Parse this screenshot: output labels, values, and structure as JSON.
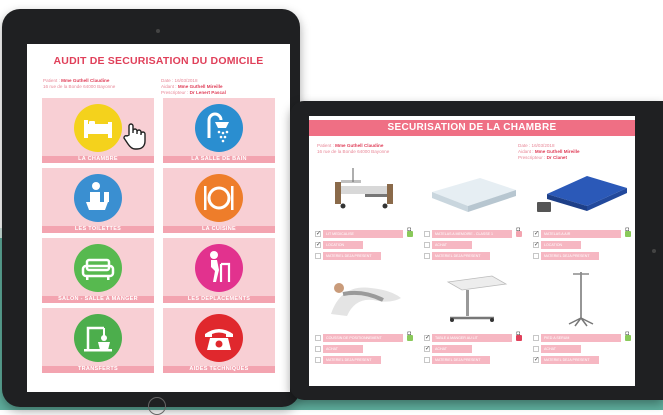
{
  "left_tablet": {
    "title": "AUDIT DE SECURISATION DU DOMICILE",
    "meta_left": [
      {
        "label": "Patient : ",
        "value": "Mme Guthell Claudine"
      },
      {
        "label": "",
        "value": "16 rue de la Bonde 64000 Bayonne"
      }
    ],
    "meta_right": [
      {
        "label": "Date : ",
        "value": "16/03/2018"
      },
      {
        "label": "Aidant : ",
        "value": "Mme Guthell Mireille"
      },
      {
        "label": "Prescripteur : ",
        "value": "Dr Lenert Pascal"
      }
    ],
    "tiles": [
      {
        "label": "LA CHAMBRE",
        "icon": "bed-icon",
        "color": "#f4d21c"
      },
      {
        "label": "LA SALLE DE BAIN",
        "icon": "shower-icon",
        "color": "#2a8ed0"
      },
      {
        "label": "LES TOILETTES",
        "icon": "toilet-icon",
        "color": "#3a8fd1"
      },
      {
        "label": "LA CUISINE",
        "icon": "cutlery-icon",
        "color": "#ee7d2a"
      },
      {
        "label": "SALON - SALLE A MANGER",
        "icon": "sofa-icon",
        "color": "#57b94f"
      },
      {
        "label": "LES DEPLACEMENTS",
        "icon": "walker-icon",
        "color": "#e2328e"
      },
      {
        "label": "TRANSFERTS",
        "icon": "transfer-icon",
        "color": "#4cae4c"
      },
      {
        "label": "AIDES TECHNIQUES",
        "icon": "telephone-icon",
        "color": "#e0282d"
      }
    ]
  },
  "right_tablet": {
    "title": "SECURISATION DE LA CHAMBRE",
    "meta_left": [
      {
        "label": "Patient : ",
        "value": "Mme Guthell Claudine"
      },
      {
        "label": "",
        "value": "16 rue de la Bonde 64000 Bayonne"
      }
    ],
    "meta_right": [
      {
        "label": "Date : ",
        "value": "16/03/2018"
      },
      {
        "label": "Aidant : ",
        "value": "Mme Guthell Mireille"
      },
      {
        "label": "Prescripteur : ",
        "value": "Dr Clanet"
      }
    ],
    "products": [
      {
        "name": "hospital-bed",
        "rows": [
          {
            "text": "LIT MEDICALISE",
            "checked": true,
            "dot": "#8ac95a"
          },
          {
            "text": "LOCATION",
            "checked": true,
            "dot": ""
          },
          {
            "text": "MATERIEL DEJA PRESENT",
            "checked": false,
            "dot": ""
          }
        ]
      },
      {
        "name": "mattress",
        "rows": [
          {
            "text": "MATELAS A MEMOIRE - CLASSE 1",
            "checked": false,
            "dot": "#f3a4b0"
          },
          {
            "text": "ACHAT",
            "checked": false,
            "dot": ""
          },
          {
            "text": "MATERIEL DEJA PRESENT",
            "checked": false,
            "dot": ""
          }
        ]
      },
      {
        "name": "air-mattress",
        "rows": [
          {
            "text": "MATELAS A AIR",
            "checked": true,
            "dot": "#8ac95a"
          },
          {
            "text": "LOCATION",
            "checked": true,
            "dot": ""
          },
          {
            "text": "MATERIEL DEJA PRESENT",
            "checked": false,
            "dot": ""
          }
        ]
      },
      {
        "name": "positioning-cushion",
        "rows": [
          {
            "text": "COUSSIN DE POSITIONNEMENT",
            "checked": false,
            "dot": "#8ac95a"
          },
          {
            "text": "ACHAT",
            "checked": false,
            "dot": ""
          },
          {
            "text": "MATERIEL DEJA PRESENT",
            "checked": false,
            "dot": ""
          }
        ]
      },
      {
        "name": "bed-table",
        "rows": [
          {
            "text": "TABLE A MANGER AU LIT",
            "checked": true,
            "dot": "#e0405a"
          },
          {
            "text": "ACHAT",
            "checked": true,
            "dot": ""
          },
          {
            "text": "MATERIEL DEJA PRESENT",
            "checked": false,
            "dot": ""
          }
        ]
      },
      {
        "name": "iv-pole",
        "rows": [
          {
            "text": "PIED A SERUM",
            "checked": false,
            "dot": "#8ac95a"
          },
          {
            "text": "ACHAT",
            "checked": false,
            "dot": ""
          },
          {
            "text": "MATERIEL DEJA PRESENT",
            "checked": true,
            "dot": ""
          }
        ]
      }
    ]
  }
}
